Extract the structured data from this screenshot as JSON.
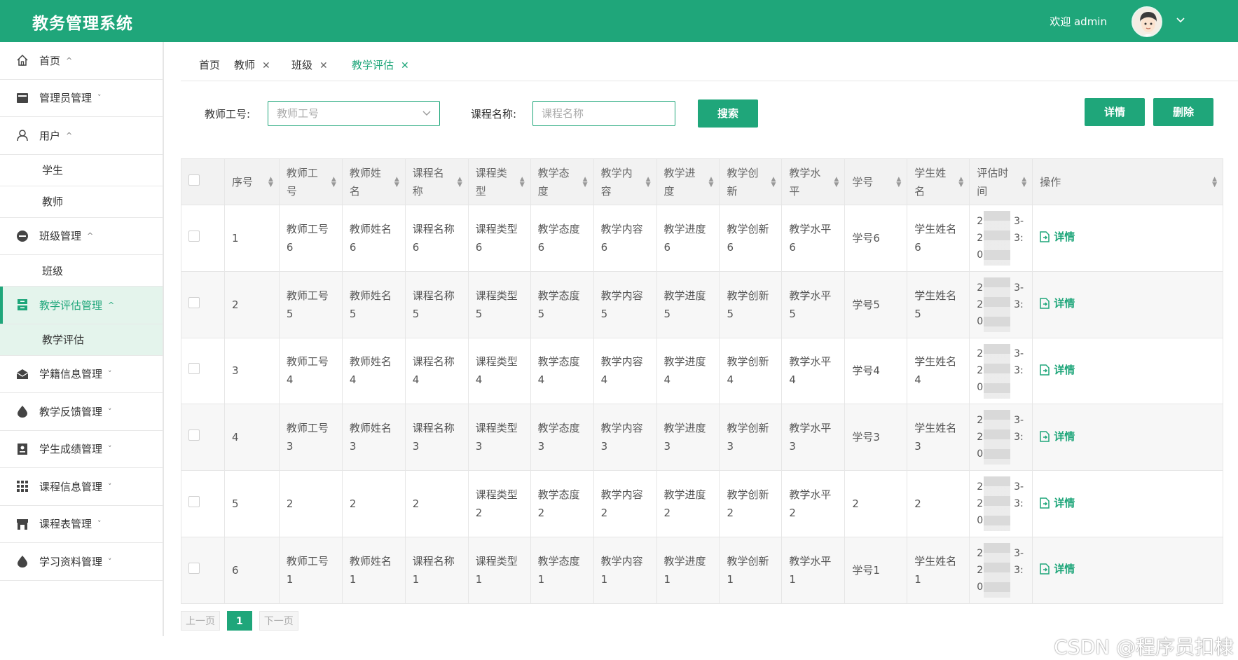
{
  "header": {
    "title": "教务管理系统",
    "welcome": "欢迎 admin"
  },
  "sidebar": {
    "items": [
      {
        "label": "首页",
        "icon": "home-icon",
        "arrow": "^"
      },
      {
        "label": "管理员管理",
        "icon": "card-icon",
        "arrow": "˅"
      },
      {
        "label": "用户",
        "icon": "user-icon",
        "arrow": "^"
      },
      {
        "label": "学生",
        "sub": true
      },
      {
        "label": "教师",
        "sub": true
      },
      {
        "label": "班级管理",
        "icon": "class-icon",
        "arrow": "^"
      },
      {
        "label": "班级",
        "sub": true
      },
      {
        "label": "教学评估管理",
        "icon": "archive-icon",
        "arrow": "^",
        "active": true
      },
      {
        "label": "教学评估",
        "sub": true,
        "active": true
      },
      {
        "label": "学籍信息管理",
        "icon": "mail-icon",
        "arrow": "˅"
      },
      {
        "label": "教学反馈管理",
        "icon": "drop-icon",
        "arrow": "˅"
      },
      {
        "label": "学生成绩管理",
        "icon": "id-card-icon",
        "arrow": "˅"
      },
      {
        "label": "课程信息管理",
        "icon": "grid-icon",
        "arrow": "˅"
      },
      {
        "label": "课程表管理",
        "icon": "shop-icon",
        "arrow": "˅"
      },
      {
        "label": "学习资料管理",
        "icon": "drop-icon",
        "arrow": "˅"
      }
    ]
  },
  "tabs": [
    {
      "label": "首页",
      "closable": false
    },
    {
      "label": "教师",
      "closable": true
    },
    {
      "label": "班级",
      "closable": true
    },
    {
      "label": "教学评估",
      "closable": true,
      "active": true
    }
  ],
  "search": {
    "teacher_no_label": "教师工号:",
    "teacher_no_placeholder": "教师工号",
    "course_label": "课程名称:",
    "course_placeholder": "课程名称",
    "search_btn": "搜索",
    "detail_btn": "详情",
    "delete_btn": "删除"
  },
  "table": {
    "headers": [
      "序号",
      "教师工号",
      "教师姓名",
      "课程名称",
      "课程类型",
      "教学态度",
      "教学内容",
      "教学进度",
      "教学创新",
      "教学水平",
      "学号",
      "学生姓名",
      "评估时间",
      "操作"
    ],
    "header_lines": [
      [
        "序号"
      ],
      [
        "教师工",
        "号"
      ],
      [
        "教师姓",
        "名"
      ],
      [
        "课程名",
        "称"
      ],
      [
        "课程类",
        "型"
      ],
      [
        "教学态",
        "度"
      ],
      [
        "教学内",
        "容"
      ],
      [
        "教学进",
        "度"
      ],
      [
        "教学创",
        "新"
      ],
      [
        "教学水",
        "平"
      ],
      [
        "学号"
      ],
      [
        "学生姓",
        "名"
      ],
      [
        "评估时",
        "间"
      ],
      [
        "操作"
      ]
    ],
    "action_label": "详情",
    "rows": [
      {
        "no": "1",
        "cells": [
          [
            "教师工号",
            "6"
          ],
          [
            "教师姓名",
            "6"
          ],
          [
            "课程名称",
            "6"
          ],
          [
            "课程类型",
            "6"
          ],
          [
            "教学态度",
            "6"
          ],
          [
            "教学内容",
            "6"
          ],
          [
            "教学进度",
            "6"
          ],
          [
            "教学创新",
            "6"
          ],
          [
            "教学水平",
            "6"
          ],
          [
            "学号6"
          ],
          [
            "学生姓名",
            "6"
          ]
        ],
        "time": [
          "2",
          "3-",
          "2",
          "3:",
          "0"
        ]
      },
      {
        "no": "2",
        "cells": [
          [
            "教师工号",
            "5"
          ],
          [
            "教师姓名",
            "5"
          ],
          [
            "课程名称",
            "5"
          ],
          [
            "课程类型",
            "5"
          ],
          [
            "教学态度",
            "5"
          ],
          [
            "教学内容",
            "5"
          ],
          [
            "教学进度",
            "5"
          ],
          [
            "教学创新",
            "5"
          ],
          [
            "教学水平",
            "5"
          ],
          [
            "学号5"
          ],
          [
            "学生姓名",
            "5"
          ]
        ],
        "time": [
          "2",
          "3-",
          "2",
          "3:",
          "0"
        ]
      },
      {
        "no": "3",
        "cells": [
          [
            "教师工号",
            "4"
          ],
          [
            "教师姓名",
            "4"
          ],
          [
            "课程名称",
            "4"
          ],
          [
            "课程类型",
            "4"
          ],
          [
            "教学态度",
            "4"
          ],
          [
            "教学内容",
            "4"
          ],
          [
            "教学进度",
            "4"
          ],
          [
            "教学创新",
            "4"
          ],
          [
            "教学水平",
            "4"
          ],
          [
            "学号4"
          ],
          [
            "学生姓名",
            "4"
          ]
        ],
        "time": [
          "2",
          "3-",
          "2",
          "3:",
          "0"
        ]
      },
      {
        "no": "4",
        "cells": [
          [
            "教师工号",
            "3"
          ],
          [
            "教师姓名",
            "3"
          ],
          [
            "课程名称",
            "3"
          ],
          [
            "课程类型",
            "3"
          ],
          [
            "教学态度",
            "3"
          ],
          [
            "教学内容",
            "3"
          ],
          [
            "教学进度",
            "3"
          ],
          [
            "教学创新",
            "3"
          ],
          [
            "教学水平",
            "3"
          ],
          [
            "学号3"
          ],
          [
            "学生姓名",
            "3"
          ]
        ],
        "time": [
          "2",
          "3-",
          "2",
          "3:",
          "0"
        ]
      },
      {
        "no": "5",
        "cells": [
          [
            "2"
          ],
          [
            "2"
          ],
          [
            "2"
          ],
          [
            "课程类型",
            "2"
          ],
          [
            "教学态度",
            "2"
          ],
          [
            "教学内容",
            "2"
          ],
          [
            "教学进度",
            "2"
          ],
          [
            "教学创新",
            "2"
          ],
          [
            "教学水平",
            "2"
          ],
          [
            "2"
          ],
          [
            "2"
          ]
        ],
        "time": [
          "2",
          "3-",
          "2",
          "3:",
          "0"
        ]
      },
      {
        "no": "6",
        "cells": [
          [
            "教师工号",
            "1"
          ],
          [
            "教师姓名",
            "1"
          ],
          [
            "课程名称",
            "1"
          ],
          [
            "课程类型",
            "1"
          ],
          [
            "教学态度",
            "1"
          ],
          [
            "教学内容",
            "1"
          ],
          [
            "教学进度",
            "1"
          ],
          [
            "教学创新",
            "1"
          ],
          [
            "教学水平",
            "1"
          ],
          [
            "学号1"
          ],
          [
            "学生姓名",
            "1"
          ]
        ],
        "time": [
          "2",
          "3-",
          "2",
          "3:",
          "0"
        ]
      }
    ]
  },
  "pager": {
    "prev": "上一页",
    "current": "1",
    "next": "下一页"
  },
  "watermark": "CSDN @程序员扣棣",
  "colors": {
    "accent": "#1fa67a",
    "active_bg": "#e4f4ec"
  }
}
